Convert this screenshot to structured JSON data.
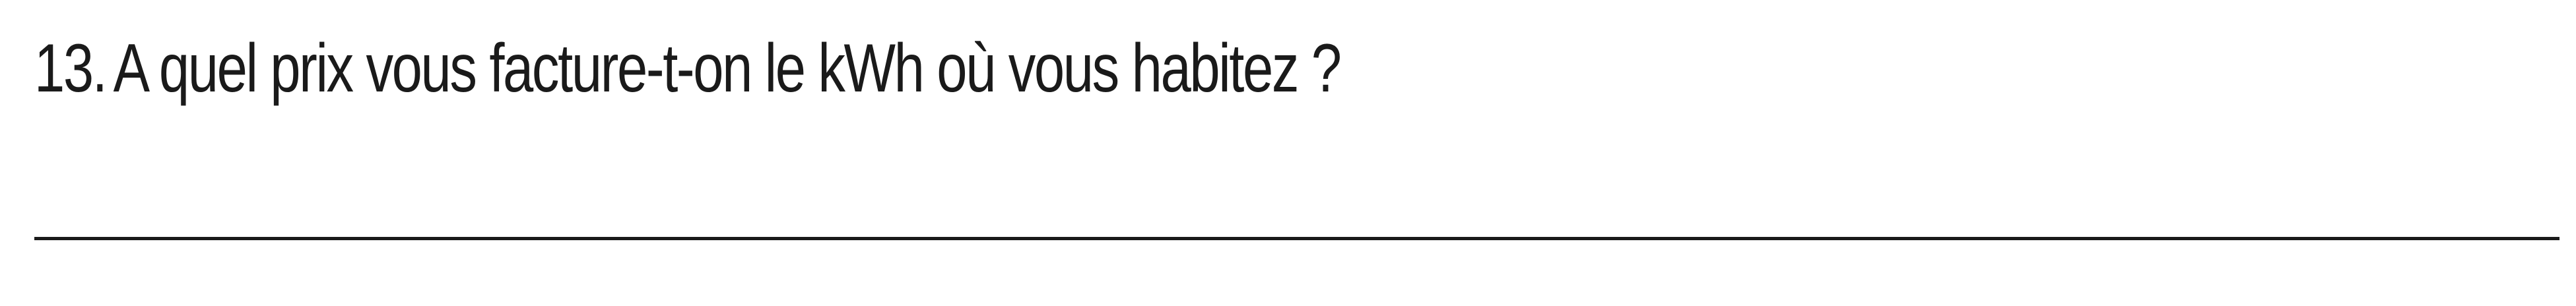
{
  "question": {
    "number": "13.",
    "text": "A quel prix vous facture-t-on le kWh où vous habitez ?"
  },
  "colors": {
    "text": "#1a1a1a",
    "background": "#ffffff"
  }
}
